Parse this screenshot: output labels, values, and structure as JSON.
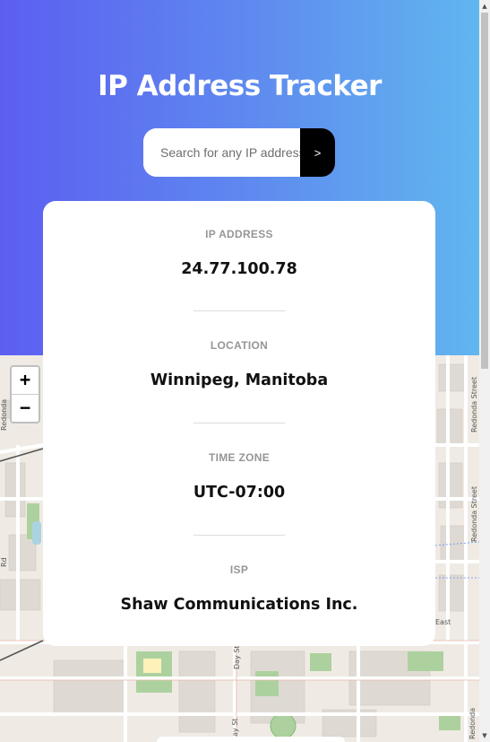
{
  "header": {
    "title": "IP Address Tracker"
  },
  "search": {
    "placeholder": "Search for any IP address or domain",
    "submit_label": ">"
  },
  "stats": {
    "ip_address": {
      "label": "IP ADDRESS",
      "value": "24.77.100.78"
    },
    "location": {
      "label": "LOCATION",
      "value": "Winnipeg, Manitoba"
    },
    "timezone": {
      "label": "TIME ZONE",
      "value": "UTC-07:00"
    },
    "isp": {
      "label": "ISP",
      "value": "Shaw Communications Inc."
    }
  },
  "map": {
    "zoom_in_label": "+",
    "zoom_out_label": "−",
    "street_labels": {
      "redonda_a": "Redonda Street",
      "redonda_b": "Redonda Street",
      "redonda_c": "Redonda",
      "day_a": "Day St",
      "day_b": "Day St",
      "east": "East",
      "left_a": "Redonda",
      "left_b": "Rd"
    }
  },
  "colors": {
    "gradient_start": "#5c5ef1",
    "gradient_end": "#60b6ef",
    "card_bg": "#ffffff",
    "label_gray": "#969696",
    "value_dark": "#111111",
    "search_button": "#000000"
  },
  "icons": {
    "scroll_up": "triangle-up",
    "scroll_down": "triangle-down"
  }
}
